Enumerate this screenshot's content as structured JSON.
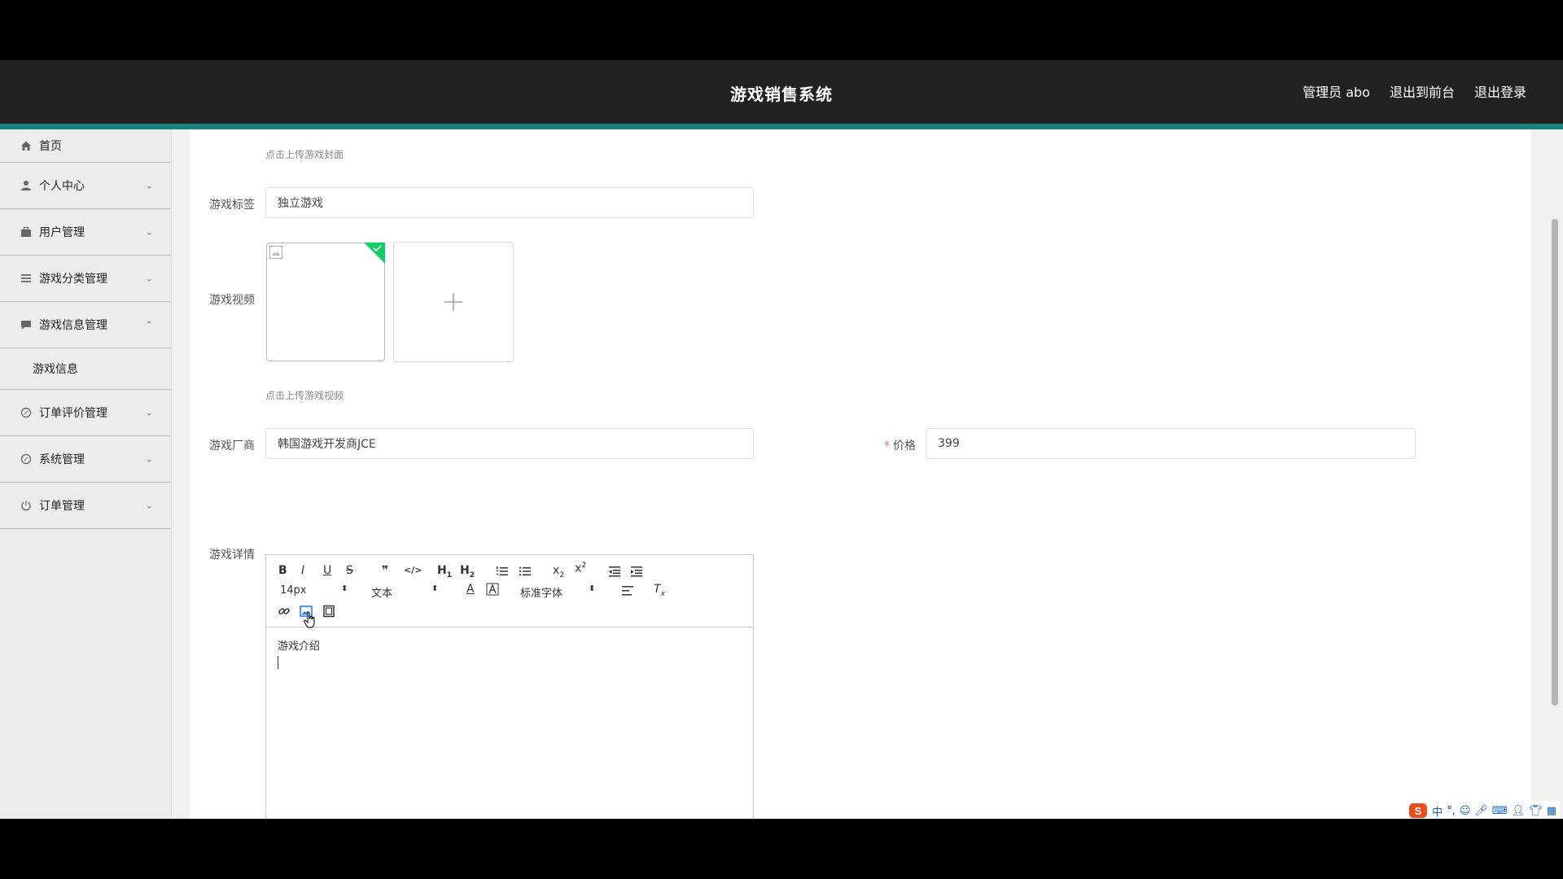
{
  "app": {
    "title": "游戏销售系统",
    "user_label": "管理员 abo",
    "exit_front": "退出到前台",
    "logout": "退出登录"
  },
  "sidebar": {
    "items": [
      {
        "label": "首页",
        "icon": "home-icon"
      },
      {
        "label": "个人中心",
        "icon": "user-icon"
      },
      {
        "label": "用户管理",
        "icon": "briefcase-icon"
      },
      {
        "label": "游戏分类管理",
        "icon": "list-icon"
      },
      {
        "label": "游戏信息管理",
        "icon": "chat-icon"
      },
      {
        "label": "订单评价管理",
        "icon": "compass-icon"
      },
      {
        "label": "系统管理",
        "icon": "compass-icon"
      },
      {
        "label": "订单管理",
        "icon": "power-icon"
      }
    ],
    "submenu": {
      "label": "游戏信息"
    }
  },
  "form": {
    "cover_hint": "点击上传游戏封面",
    "tag_label": "游戏标签",
    "tag_value": "独立游戏",
    "video_label": "游戏视频",
    "video_hint": "点击上传游戏视频",
    "vendor_label": "游戏厂商",
    "vendor_value": "韩国游戏开发商JCE",
    "price_required": "*",
    "price_label": "价格",
    "price_value": "399",
    "detail_label": "游戏详情",
    "editor": {
      "font_size": "14px",
      "header": "文本",
      "font_family": "标准字体",
      "content": "游戏介绍"
    }
  },
  "colors": {
    "topbar": "#222222",
    "accent": "#17837c",
    "success": "#13ce66"
  }
}
